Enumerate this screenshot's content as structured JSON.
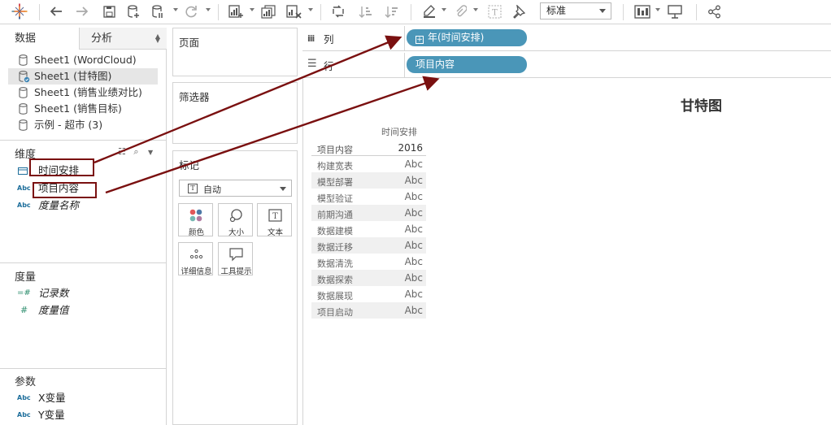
{
  "toolbar": {
    "logo": "tableau-logo-icon",
    "fit_value": "标准"
  },
  "data_pane": {
    "tabs": [
      {
        "label": "数据"
      },
      {
        "label": "分析"
      }
    ],
    "datasources": [
      {
        "label": "Sheet1 (WordCloud)",
        "selected": false
      },
      {
        "label": "Sheet1 (甘特图)",
        "selected": true
      },
      {
        "label": "Sheet1 (销售业绩对比)",
        "selected": false
      },
      {
        "label": "Sheet1 (销售目标)",
        "selected": false
      },
      {
        "label": "示例 - 超市 (3)",
        "selected": false
      }
    ],
    "dimensions_title": "维度",
    "dimensions": [
      {
        "icon": "calendar-icon",
        "label": "时间安排",
        "italic": false
      },
      {
        "icon": "Abc",
        "label": "项目内容",
        "italic": false
      },
      {
        "icon": "Abc",
        "label": "度量名称",
        "italic": true
      }
    ],
    "measures_title": "度量",
    "measures": [
      {
        "icon": "=#",
        "label": "记录数"
      },
      {
        "icon": "#",
        "label": "度量值"
      }
    ],
    "params_title": "参数",
    "params": [
      {
        "icon": "Abc",
        "label": "X变量"
      },
      {
        "icon": "Abc",
        "label": "Y变量"
      }
    ]
  },
  "cards": {
    "pages_title": "页面",
    "filters_title": "筛选器",
    "marks_title": "标记",
    "mark_type": "自动",
    "mark_buttons": [
      {
        "label": "颜色",
        "icon": "color-dots-icon"
      },
      {
        "label": "大小",
        "icon": "size-icon"
      },
      {
        "label": "文本",
        "icon": "text-icon"
      },
      {
        "label": "详细信息",
        "icon": "detail-icon"
      },
      {
        "label": "工具提示",
        "icon": "tooltip-icon"
      }
    ]
  },
  "shelves": {
    "columns_label": "列",
    "columns_pill": "年(时间安排)",
    "rows_label": "行",
    "rows_pill": "项目内容"
  },
  "view": {
    "title": "甘特图",
    "col_header": "时间安排",
    "row_header": "项目内容",
    "year": "2016",
    "rows": [
      {
        "name": "构建宽表",
        "value": "Abc"
      },
      {
        "name": "模型部署",
        "value": "Abc"
      },
      {
        "name": "模型验证",
        "value": "Abc"
      },
      {
        "name": "前期沟通",
        "value": "Abc"
      },
      {
        "name": "数据建模",
        "value": "Abc"
      },
      {
        "name": "数据迁移",
        "value": "Abc"
      },
      {
        "name": "数据清洗",
        "value": "Abc"
      },
      {
        "name": "数据探索",
        "value": "Abc"
      },
      {
        "name": "数据展现",
        "value": "Abc"
      },
      {
        "name": "项目启动",
        "value": "Abc"
      }
    ]
  },
  "colors": {
    "pill": "#4a96b8",
    "annotation": "#7a1010",
    "field_icon": "#1f6f9c"
  }
}
